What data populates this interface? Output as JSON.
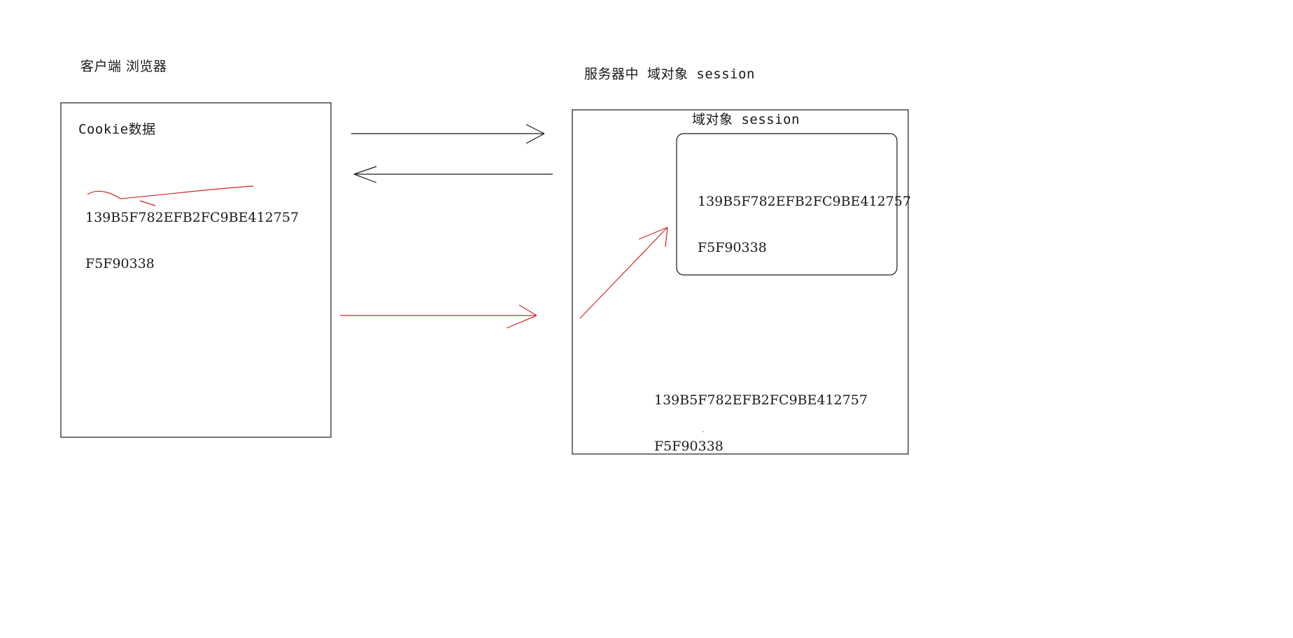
{
  "client": {
    "title": "客户端 浏览器",
    "cookie_label": "Cookie数据",
    "session_id_line1": "139B5F782EFB2FC9BE412757",
    "session_id_line2": "F5F90338"
  },
  "server": {
    "title": "服务器中 域对象 session",
    "inner_title": "域对象 session",
    "stored_id_line1": "139B5F782EFB2FC9BE412757",
    "stored_id_line2": "F5F90338",
    "incoming_id_line1": "139B5F782EFB2FC9BE412757",
    "incoming_id_line2": "F5F90338"
  },
  "colors": {
    "ink": "#1a1a1a",
    "annotation": "#d42424"
  }
}
